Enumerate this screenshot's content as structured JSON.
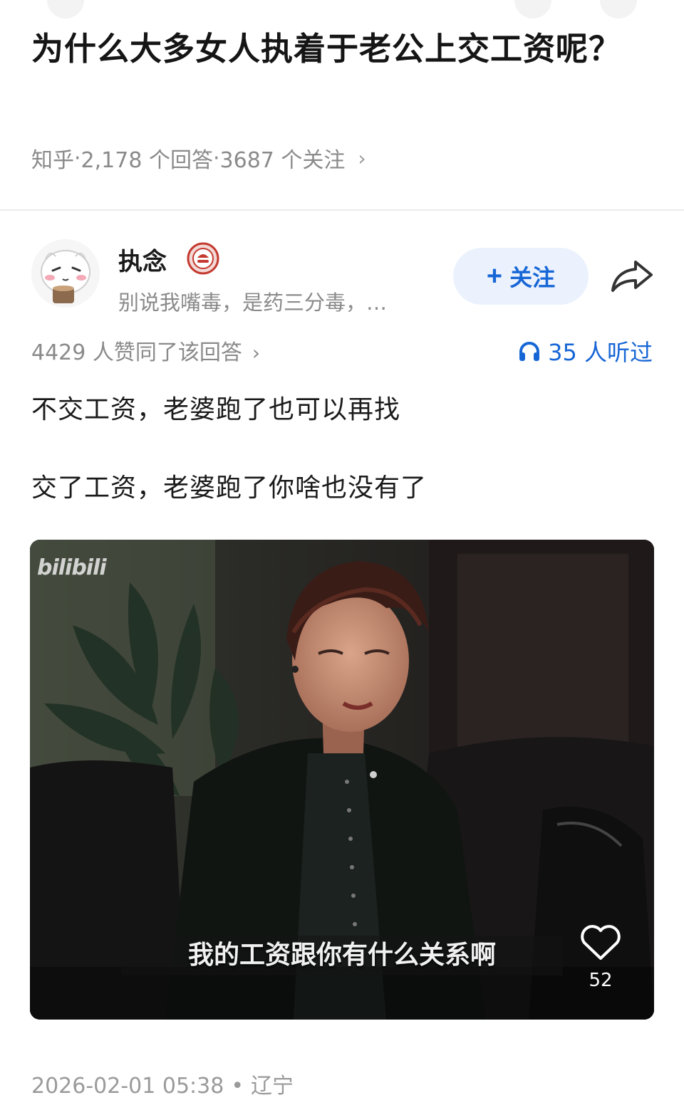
{
  "question": {
    "title": "为什么大多女人执着于老公上交工资呢？",
    "source": "知乎",
    "answers": "2,178 个回答",
    "followers": "3687 个关注",
    "separator": " · "
  },
  "author": {
    "name": "执念",
    "bio": "别说我嘴毒，是药三分毒，…",
    "follow_label": "关注",
    "avatar_icon": "cartoon-avatar",
    "badge_icon": "achievement-badge",
    "share_icon": "share-arrow-icon"
  },
  "stats": {
    "votes_text": "4429 人赞同了该回答",
    "listened_text": "35 人听过"
  },
  "content": {
    "paragraphs": [
      "不交工资，老婆跑了也可以再找",
      "交了工资，老婆跑了你啥也没有了"
    ]
  },
  "video": {
    "watermark": "bilibili",
    "subtitle": "我的工资跟你有什么关系啊",
    "like_count": "52"
  },
  "footer": {
    "datetime": "2026-02-01 05:38",
    "location": "辽宁"
  },
  "colors": {
    "accent_blue": "#1766d6",
    "follow_bg": "#ebf2fd",
    "meta_gray": "#8a8a8a"
  }
}
